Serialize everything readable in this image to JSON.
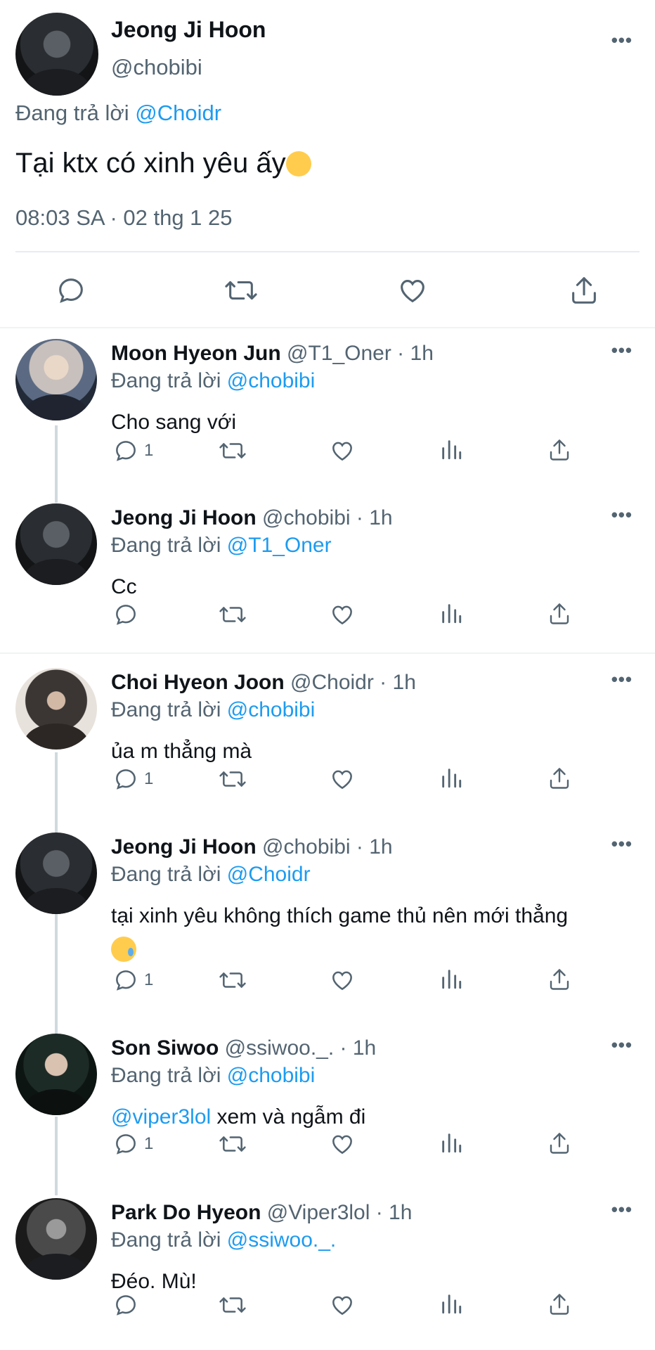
{
  "main_tweet": {
    "name": "Jeong Ji Hoon",
    "handle": "@chobibi",
    "replying_prefix": "Đang trả lời",
    "replying_to": "@Choidr",
    "text": "Tại ktx có xinh yêu ấy",
    "emoji": "😌",
    "timestamp": "08:03 SA · 02 thg 1 25",
    "actions": [
      "reply-icon",
      "retweet-icon",
      "like-icon",
      "share-icon"
    ]
  },
  "replies": [
    {
      "name": "Moon Hyeon Jun",
      "handle": "@T1_Oner · 1h",
      "replying_prefix": "Đang trả lời",
      "replying_to": "@chobibi",
      "text": "Cho sang với",
      "reply_count": "1"
    },
    {
      "name": "Jeong Ji Hoon",
      "handle": "@chobibi · 1h",
      "replying_prefix": "Đang trả lời",
      "replying_to": "@T1_Oner",
      "text": "Cc",
      "reply_count": ""
    },
    {
      "name": "Choi Hyeon Joon",
      "handle": "@Choidr · 1h",
      "replying_prefix": "Đang trả lời",
      "replying_to": "@chobibi",
      "text": "ủa m thẳng mà",
      "reply_count": "1"
    },
    {
      "name": "Jeong Ji Hoon",
      "handle": "@chobibi · 1h",
      "replying_prefix": "Đang trả lời",
      "replying_to": "@Choidr",
      "text": "tại xinh yêu không thích game thủ nên mới thẳng",
      "emoji": "😢",
      "reply_count": "1"
    },
    {
      "name": "Son Siwoo",
      "handle": "@ssiwoo._. · 1h",
      "replying_prefix": "Đang trả lời",
      "replying_to": "@chobibi",
      "mention": "@viper3lol",
      "text": " xem và ngẫm đi",
      "reply_count": "1"
    },
    {
      "name": "Park Do Hyeon",
      "handle": "@Viper3lol · 1h",
      "replying_prefix": "Đang trả lời",
      "replying_to": "@ssiwoo._.",
      "text": "Đéo. Mù!",
      "reply_count": ""
    }
  ],
  "more_label": "•••",
  "colors": {
    "link": "#1d9bf0",
    "muted": "#536471",
    "text": "#0f1419",
    "separator": "#eff3f4"
  }
}
